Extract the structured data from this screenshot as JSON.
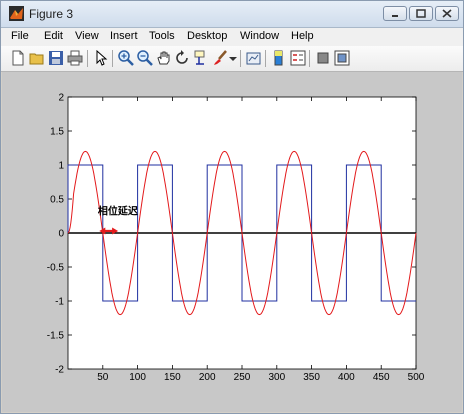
{
  "window": {
    "title": "Figure 3"
  },
  "menubar": {
    "items": [
      "File",
      "Edit",
      "View",
      "Insert",
      "Tools",
      "Desktop",
      "Window",
      "Help"
    ]
  },
  "toolbar": {
    "buttons": [
      "new-figure",
      "open-file",
      "save-figure",
      "print-figure",
      "edit-plot",
      "zoom-in",
      "zoom-out",
      "pan",
      "rotate-3d",
      "data-cursor",
      "brush",
      "link-plot",
      "insert-colorbar",
      "insert-legend",
      "hide-plot-tools",
      "show-plot-tools"
    ]
  },
  "colors": {
    "sine": "#e31a1c",
    "square": "#1f2fa0",
    "axis_line": "#000000",
    "figure_bg": "#c8c8c8"
  },
  "chart_data": {
    "type": "line",
    "xlim": [
      0,
      500
    ],
    "ylim": [
      -2,
      2
    ],
    "xticks": [
      50,
      100,
      150,
      200,
      250,
      300,
      350,
      400,
      450,
      500
    ],
    "yticks": [
      2,
      1.5,
      1,
      0.5,
      0,
      -0.5,
      -1,
      -1.5,
      -2
    ],
    "grid": false,
    "series": [
      {
        "kind": "square",
        "color": "#1f2fa0",
        "amplitude": 1,
        "period": 100,
        "start_x": 0,
        "end_x": 500,
        "initial_level": 0,
        "first_high": 0,
        "first_low": 50
      },
      {
        "kind": "sine",
        "color": "#e31a1c",
        "amplitude": 1.2,
        "period": 100,
        "phase_delay": 25,
        "end_x": 500
      }
    ],
    "annotations": [
      {
        "text": "相位延迟",
        "x": 43,
        "y": 0.27,
        "arrow_from": 45,
        "arrow_to": 72,
        "arrow_y": 0.03
      }
    ]
  }
}
